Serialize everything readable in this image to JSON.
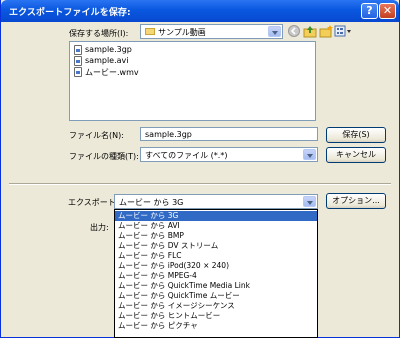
{
  "window": {
    "title": "エクスポートファイルを保存:",
    "help_glyph": "?",
    "close_glyph": "✕"
  },
  "location": {
    "label": "保存する場所(I):",
    "value": "サンプル動画"
  },
  "toolbar": {
    "icons": [
      "back-icon",
      "up-folder-icon",
      "new-folder-icon",
      "view-menu-icon"
    ]
  },
  "files": [
    {
      "name": "sample.3gp",
      "icon": "movie-file-icon"
    },
    {
      "name": "sample.avi",
      "icon": "movie-file-icon"
    },
    {
      "name": "ムービー.wmv",
      "icon": "movie-file-icon"
    }
  ],
  "filename": {
    "label": "ファイル名(N):",
    "value": "sample.3gp"
  },
  "filetype": {
    "label": "ファイルの種類(T):",
    "value": "すべてのファイル (*.*)"
  },
  "buttons": {
    "save": "保存(S)",
    "cancel": "キャンセル",
    "options": "オプション..."
  },
  "export": {
    "label": "エクスポート:",
    "value": "ムービー から 3G",
    "options": [
      "ムービー から 3G",
      "ムービー から AVI",
      "ムービー から BMP",
      "ムービー から DV ストリーム",
      "ムービー から FLC",
      "ムービー から iPod(320 × 240)",
      "ムービー から MPEG-4",
      "ムービー から QuickTime Media Link",
      "ムービー から QuickTime ムービー",
      "ムービー から イメージシーケンス",
      "ムービー から ヒントムービー",
      "ムービー から ピクチャ"
    ],
    "selected_index": 0
  },
  "output": {
    "label": "出力:"
  }
}
